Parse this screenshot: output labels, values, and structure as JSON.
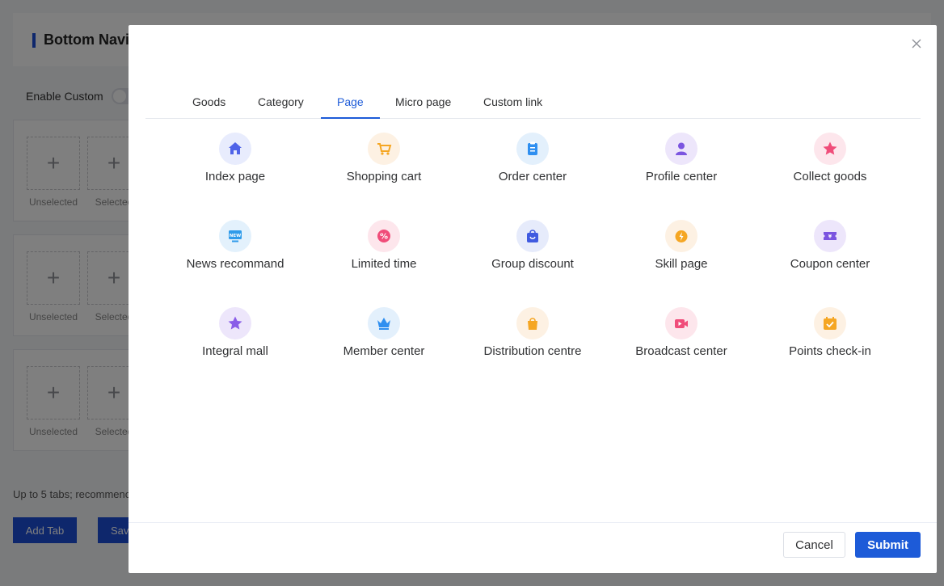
{
  "background": {
    "header_title": "Bottom Navi",
    "enable_label": "Enable Custom",
    "slot_labels": [
      "Unselected",
      "Selected"
    ],
    "note": "Up to 5 tabs; recommenc",
    "add_tab_label": "Add Tab",
    "save_label": "Sav"
  },
  "dialog": {
    "tabs": [
      {
        "label": "Goods"
      },
      {
        "label": "Category"
      },
      {
        "label": "Page"
      },
      {
        "label": "Micro page"
      },
      {
        "label": "Custom link"
      }
    ],
    "active_tab": "Page",
    "items": [
      {
        "label": "Index page",
        "icon": "home-icon",
        "bg": "#e8ecfd",
        "color": "#4f63e8"
      },
      {
        "label": "Shopping cart",
        "icon": "cart-icon",
        "bg": "#fdf1e3",
        "color": "#f5a623"
      },
      {
        "label": "Order center",
        "icon": "clipboard-icon",
        "bg": "#e3f0fc",
        "color": "#2f8ff0"
      },
      {
        "label": "Profile center",
        "icon": "user-icon",
        "bg": "#ede6fb",
        "color": "#7b55e0"
      },
      {
        "label": "Collect goods",
        "icon": "star-icon",
        "bg": "#fde6ec",
        "color": "#f04d7a"
      },
      {
        "label": "News recommand",
        "icon": "news-icon",
        "bg": "#e3f1fc",
        "color": "#2f9bea"
      },
      {
        "label": "Limited time",
        "icon": "percent-icon",
        "bg": "#fde6ec",
        "color": "#f04d7a"
      },
      {
        "label": "Group discount",
        "icon": "bag-icon",
        "bg": "#e6ebfb",
        "color": "#3f5ae0"
      },
      {
        "label": "Skill page",
        "icon": "alarm-icon",
        "bg": "#fdf1e3",
        "color": "#f5a623"
      },
      {
        "label": "Coupon center",
        "icon": "coupon-icon",
        "bg": "#ede6fb",
        "color": "#7b55e0"
      },
      {
        "label": "Integral mall",
        "icon": "star-icon",
        "bg": "#ede6fb",
        "color": "#8a5de8"
      },
      {
        "label": "Member center",
        "icon": "crown-icon",
        "bg": "#e3f0fc",
        "color": "#2f8ff0"
      },
      {
        "label": "Distribution centre",
        "icon": "shopping-bag-icon",
        "bg": "#fdf1e3",
        "color": "#f5a623"
      },
      {
        "label": "Broadcast center",
        "icon": "video-icon",
        "bg": "#fde6ec",
        "color": "#f04d7a"
      },
      {
        "label": "Points check-in",
        "icon": "calendar-check-icon",
        "bg": "#fdf1e3",
        "color": "#f5a623"
      }
    ],
    "cancel_label": "Cancel",
    "submit_label": "Submit"
  }
}
